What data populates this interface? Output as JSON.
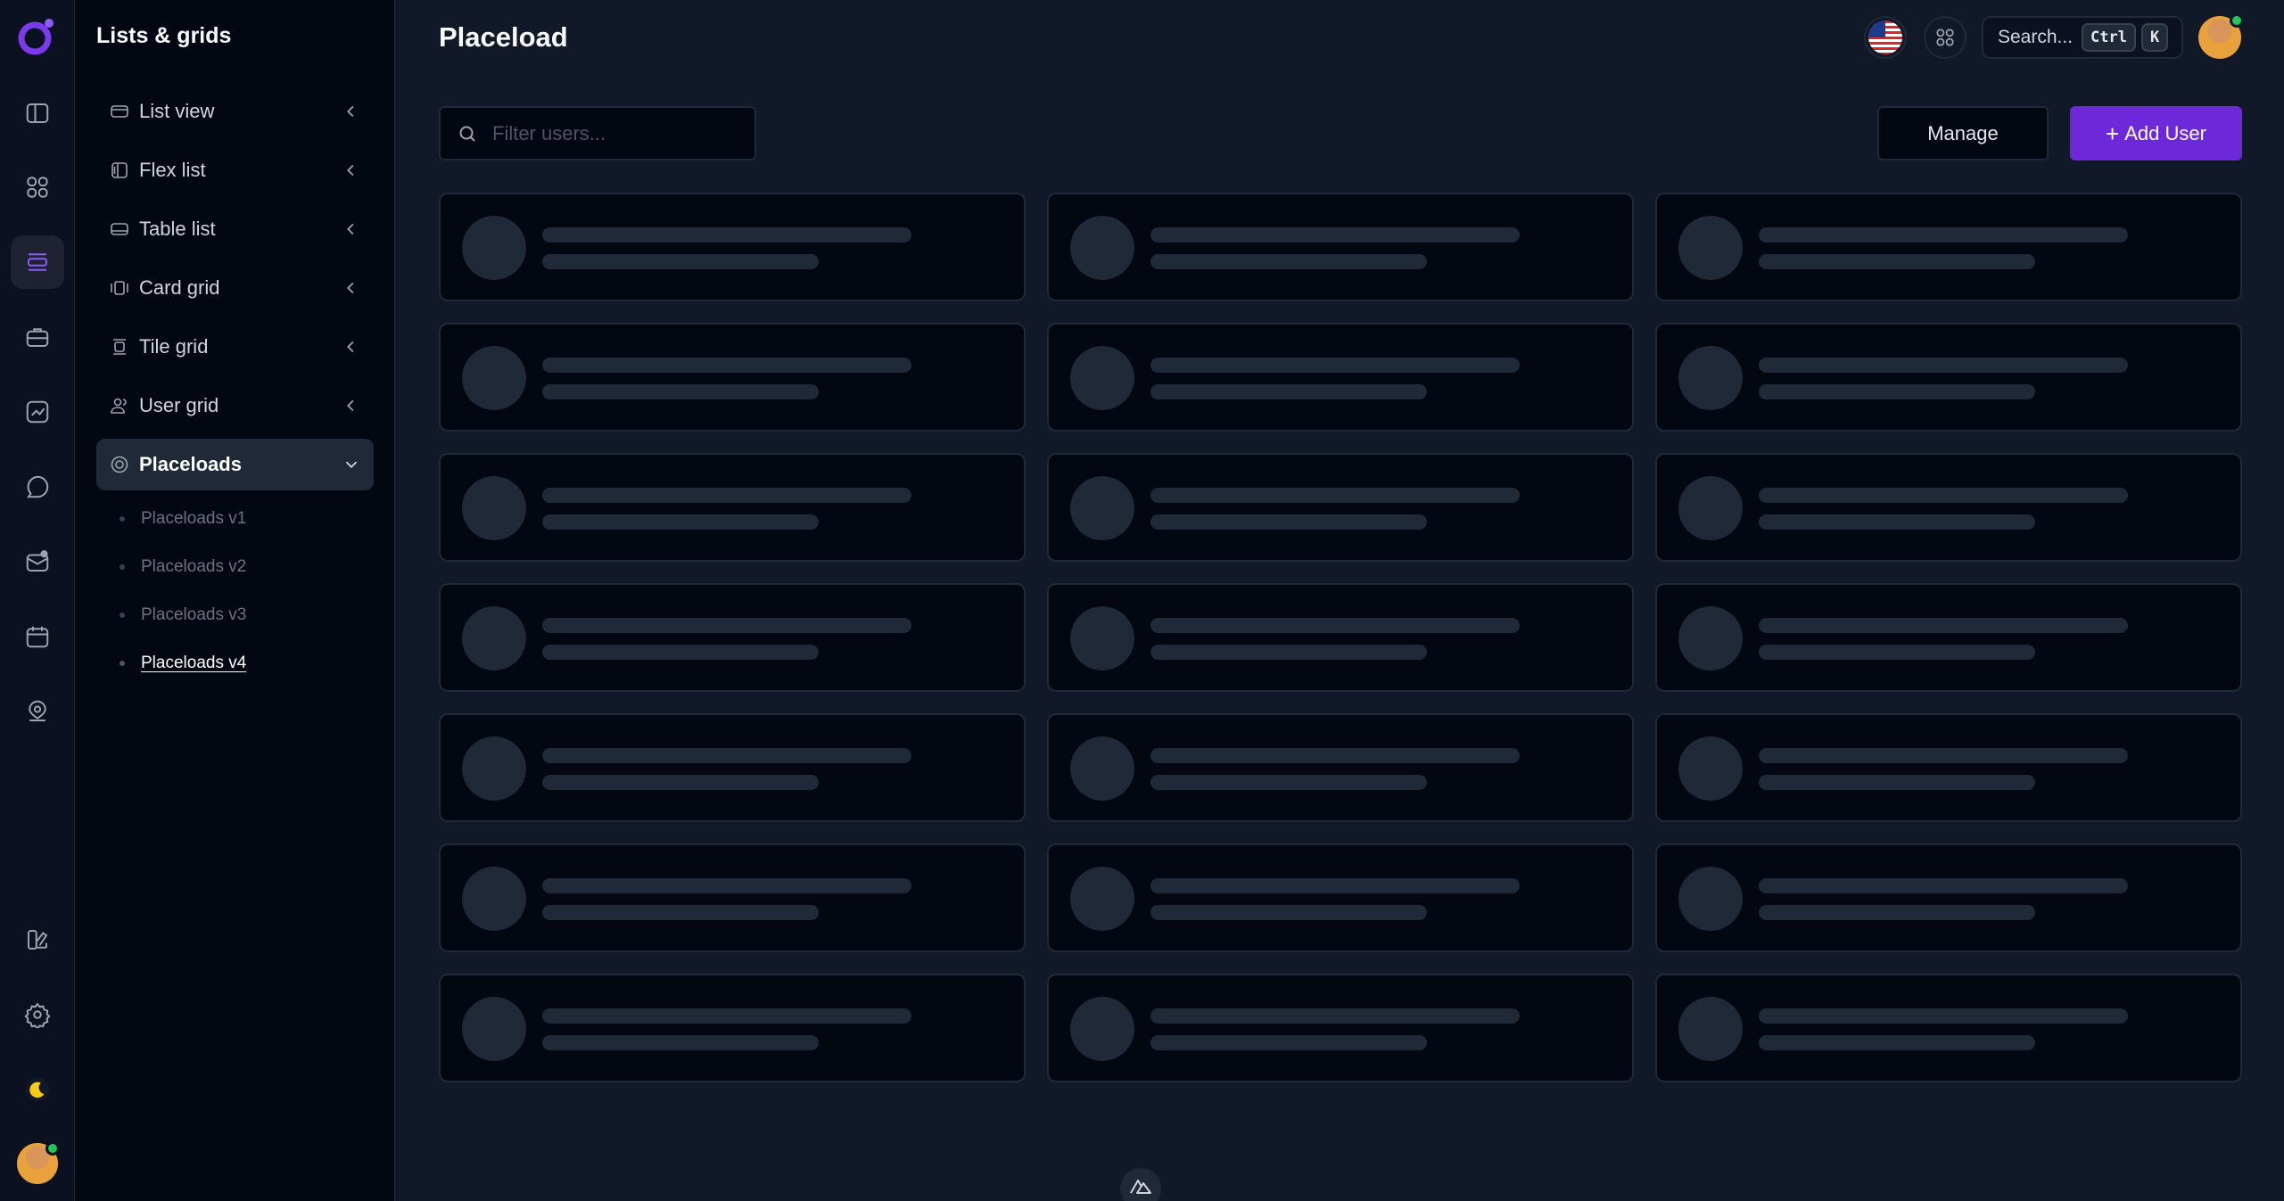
{
  "app": {
    "accent_color": "#7c3aed"
  },
  "rail": {
    "logo_icon": "app-logo-icon",
    "items": [
      {
        "icon": "sidebar-layout-icon",
        "active": false
      },
      {
        "icon": "grid-icon",
        "active": false
      },
      {
        "icon": "list-icon",
        "active": true
      },
      {
        "icon": "briefcase-icon",
        "active": false
      },
      {
        "icon": "chart-icon",
        "active": false
      },
      {
        "icon": "chat-icon",
        "active": false
      },
      {
        "icon": "mail-icon",
        "active": false
      },
      {
        "icon": "calendar-icon",
        "active": false
      },
      {
        "icon": "map-pin-icon",
        "active": false
      }
    ],
    "bottom_items": [
      {
        "icon": "palette-icon"
      },
      {
        "icon": "gear-icon"
      },
      {
        "icon": "moon-icon"
      }
    ]
  },
  "sidebar": {
    "title": "Lists & grids",
    "items": [
      {
        "label": "List view",
        "icon": "list-view-icon",
        "expanded": false
      },
      {
        "label": "Flex list",
        "icon": "flex-list-icon",
        "expanded": false
      },
      {
        "label": "Table list",
        "icon": "table-list-icon",
        "expanded": false
      },
      {
        "label": "Card grid",
        "icon": "card-grid-icon",
        "expanded": false
      },
      {
        "label": "Tile grid",
        "icon": "tile-grid-icon",
        "expanded": false
      },
      {
        "label": "User grid",
        "icon": "users-icon",
        "expanded": false
      },
      {
        "label": "Placeloads",
        "icon": "placeload-icon",
        "expanded": true
      }
    ],
    "subitems": [
      {
        "label": "Placeloads v1",
        "active": false
      },
      {
        "label": "Placeloads v2",
        "active": false
      },
      {
        "label": "Placeloads v3",
        "active": false
      },
      {
        "label": "Placeloads v4",
        "active": true
      }
    ]
  },
  "header": {
    "title": "Placeload",
    "language_icon": "us-flag-icon",
    "apps_icon": "apps-grid-icon",
    "search": {
      "label": "Search...",
      "shortcut_keys": [
        "Ctrl",
        "K"
      ]
    }
  },
  "toolbar": {
    "filter_placeholder": "Filter users...",
    "manage_label": "Manage",
    "add_user_label": "Add User"
  },
  "grid": {
    "columns": 3,
    "rows": 7,
    "state": "loading"
  }
}
